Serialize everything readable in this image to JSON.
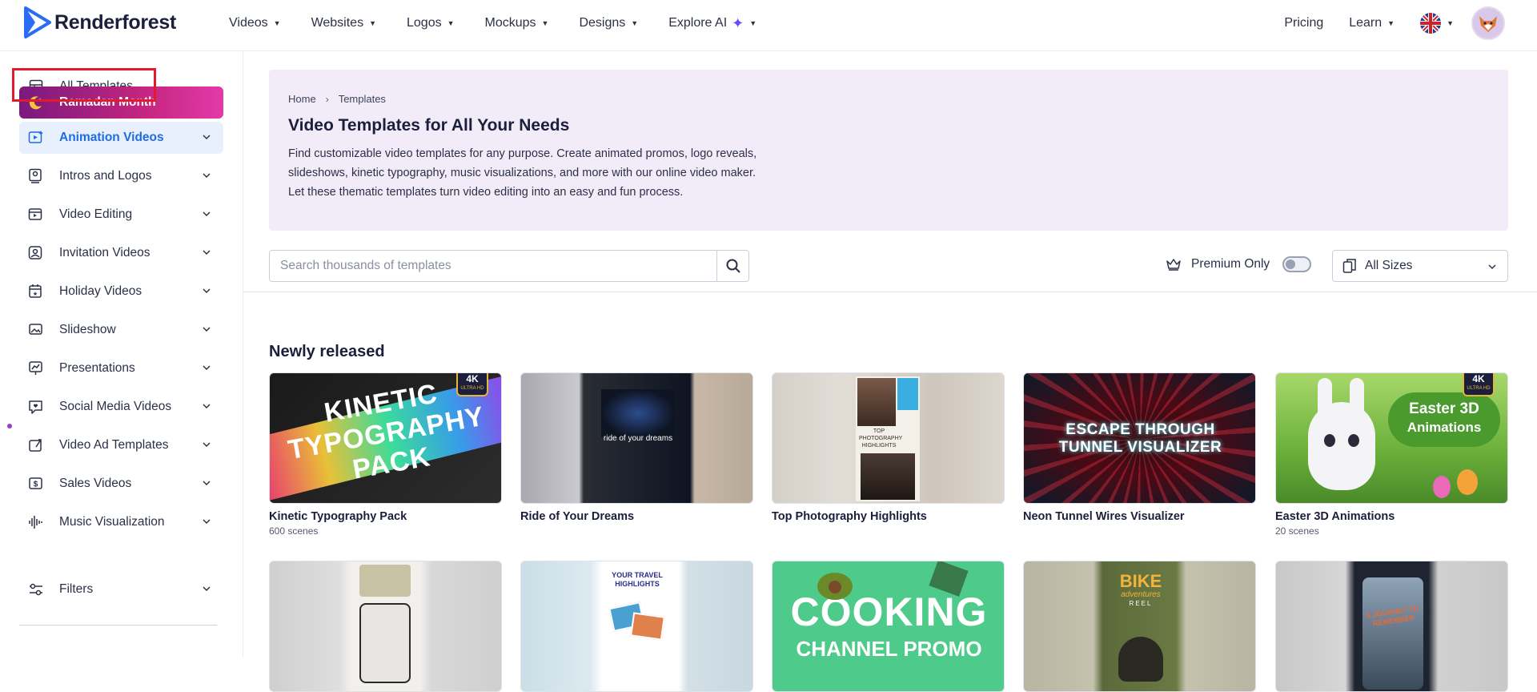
{
  "brand": {
    "name": "Renderforest"
  },
  "nav": {
    "items": [
      {
        "label": "Videos"
      },
      {
        "label": "Websites"
      },
      {
        "label": "Logos"
      },
      {
        "label": "Mockups"
      },
      {
        "label": "Designs"
      },
      {
        "label": "Explore AI"
      }
    ],
    "pricing": "Pricing",
    "learn": "Learn"
  },
  "sidebar": {
    "items": [
      {
        "label": "All Templates",
        "icon": "templates-icon"
      },
      {
        "label": "Ramadan Month",
        "icon": "crescent-moon-icon"
      },
      {
        "label": "Animation Videos",
        "icon": "animation-icon"
      },
      {
        "label": "Intros and Logos",
        "icon": "intro-icon"
      },
      {
        "label": "Video Editing",
        "icon": "video-edit-icon"
      },
      {
        "label": "Invitation Videos",
        "icon": "invitation-icon"
      },
      {
        "label": "Holiday Videos",
        "icon": "calendar-star-icon"
      },
      {
        "label": "Slideshow",
        "icon": "slideshow-icon"
      },
      {
        "label": "Presentations",
        "icon": "presentation-icon"
      },
      {
        "label": "Social Media Videos",
        "icon": "social-media-icon"
      },
      {
        "label": "Video Ad Templates",
        "icon": "ad-icon"
      },
      {
        "label": "Sales Videos",
        "icon": "sales-icon"
      },
      {
        "label": "Music Visualization",
        "icon": "waveform-icon"
      }
    ],
    "filters": "Filters"
  },
  "hero": {
    "breadcrumb": [
      "Home",
      "Templates"
    ],
    "title": "Video Templates for All Your Needs",
    "desc1": "Find customizable video templates for any purpose. Create animated promos, logo reveals,",
    "desc2": "slideshows, kinetic typography, music visualizations, and more with our online video maker.",
    "desc3": "Let these thematic templates turn video editing into an easy and fun process."
  },
  "search": {
    "placeholder": "Search thousands of templates"
  },
  "premium": {
    "label": "Premium Only",
    "enabled": false
  },
  "sizes": {
    "label": "All Sizes"
  },
  "section": {
    "title": "Newly released"
  },
  "cards": [
    {
      "title": "Kinetic Typography Pack",
      "sub": "600 scenes",
      "badge": "4K",
      "badge_sub": "ULTRA HD",
      "art": "KINETIC TYPOGRAPHY PACK"
    },
    {
      "title": "Ride of Your Dreams",
      "sub": "",
      "art": "ride of your dreams"
    },
    {
      "title": "Top Photography Highlights",
      "sub": "",
      "art": "TOP PHOTOGRAPHY HIGHLIGHTS"
    },
    {
      "title": "Neon Tunnel Wires Visualizer",
      "sub": "",
      "art1": "ESCAPE THROUGH",
      "art2": "TUNNEL VISUALIZER"
    },
    {
      "title": "Easter 3D Animations",
      "sub": "20 scenes",
      "badge": "4K",
      "badge_sub": "ULTRA HD",
      "art1": "Easter 3D",
      "art2": "Animations"
    }
  ],
  "cards_row2": [
    {
      "art": ""
    },
    {
      "art": "YOUR TRAVEL HIGHLIGHTS"
    },
    {
      "art1": "COOKING",
      "art2": "CHANNEL PROMO"
    },
    {
      "art1": "BIKE",
      "art2": "adventures",
      "art3": "REEL"
    },
    {
      "art": "A JOURNEY TO REMEMBER"
    }
  ],
  "colors": {
    "accent": "#1f6ce0",
    "highlight": "#e21b2c",
    "hero_bg": "#f2ecf9"
  }
}
